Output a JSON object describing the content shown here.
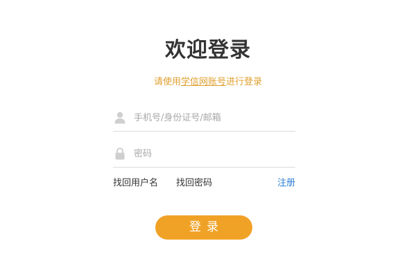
{
  "header": {
    "title": "欢迎登录",
    "subtitle_prefix": "请使用",
    "subtitle_link": "学信网账号",
    "subtitle_suffix": "进行登录"
  },
  "form": {
    "username": {
      "icon": "user-icon",
      "placeholder": "手机号/身份证号/邮箱",
      "value": ""
    },
    "password": {
      "icon": "lock-icon",
      "placeholder": "密码",
      "value": ""
    }
  },
  "links": {
    "find_username": "找回用户名",
    "find_password": "找回密码",
    "register": "注册"
  },
  "login_button": {
    "label": "登录"
  },
  "colors": {
    "accent": "#f0a227",
    "subtitle": "#e0a030",
    "link": "#2b7dd6",
    "title": "#333333"
  }
}
